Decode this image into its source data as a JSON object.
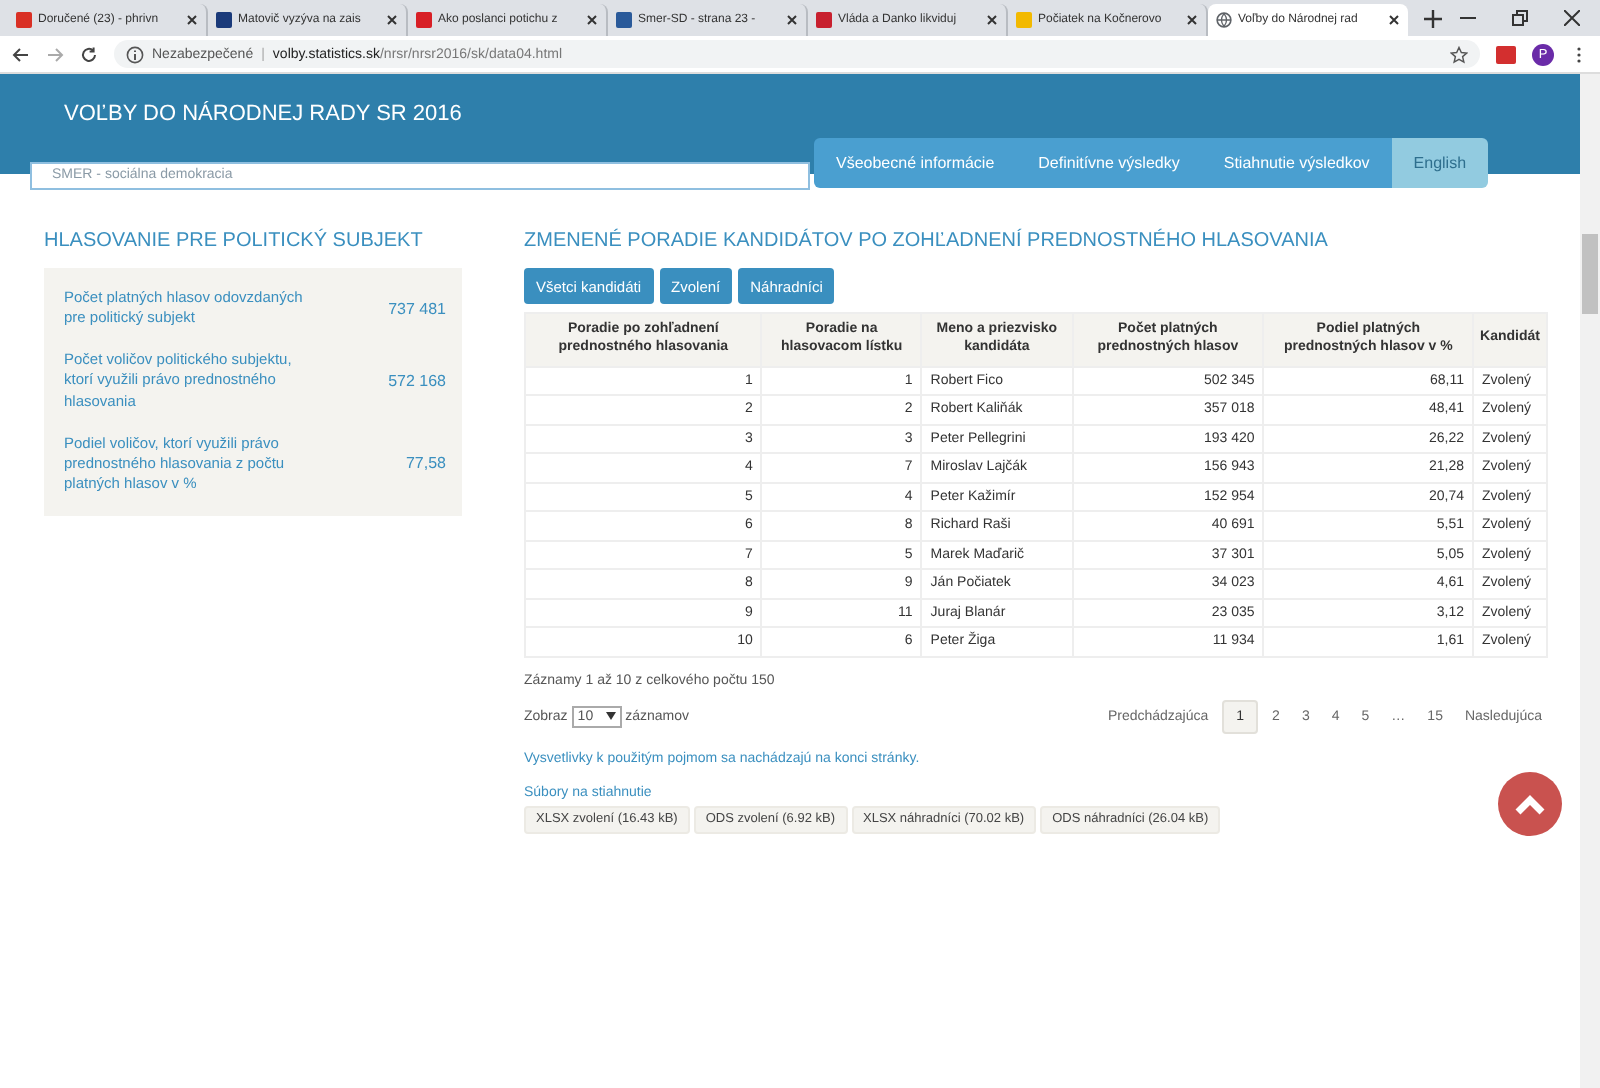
{
  "browser": {
    "tabs": [
      {
        "title": "Doručené (23) - phrivn",
        "selected": false
      },
      {
        "title": "Matovič vyzýva na zais",
        "selected": false
      },
      {
        "title": "Ako poslanci potichu z",
        "selected": false
      },
      {
        "title": "Smer-SD - strana 23 -",
        "selected": false
      },
      {
        "title": "Vláda a Danko likviduj",
        "selected": false
      },
      {
        "title": "Počiatek na Kočnerovo",
        "selected": false
      },
      {
        "title": "Voľby do Národnej rad",
        "selected": true
      }
    ],
    "security": "Nezabezpečené",
    "separator": "|",
    "url_host": "volby.statistics.sk",
    "url_path": "/nrsr/nrsr2016/sk/data04.html",
    "profile": "P"
  },
  "header": {
    "title": "VOĽBY DO NÁRODNEJ RADY SR 2016",
    "nav": [
      {
        "label": "Všeobecné informácie",
        "selected": false
      },
      {
        "label": "Definitívne výsledky",
        "selected": false
      },
      {
        "label": "Stiahnutie výsledkov",
        "selected": false
      },
      {
        "label": "English",
        "selected": true
      }
    ]
  },
  "party_field": {
    "value": "SMER - sociálna demokracia"
  },
  "summary": {
    "title": "HLASOVANIE PRE POLITICKÝ SUBJEKT",
    "rows": [
      {
        "label": "Počet platných hlasov odovzdaných pre politický subjekt",
        "value": "737 481"
      },
      {
        "label": "Počet voličov politického subjektu, ktorí využili právo prednostného hlasovania",
        "value": "572 168"
      },
      {
        "label": "Podiel voličov, ktorí využili právo prednostného hlasovania z počtu platných hlasov v %",
        "value": "77,58"
      }
    ]
  },
  "results": {
    "title": "ZMENENÉ PORADIE KANDIDÁTOV PO ZOHĽADNENÍ PREDNOSTNÉHO HLASOVANIA",
    "filters": [
      "Všetci kandidáti",
      "Zvolení",
      "Náhradníci"
    ],
    "columns": [
      "Poradie po zohľadnení prednostného hlasovania",
      "Poradie na hlasovacom lístku",
      "Meno a priezvisko kandidáta",
      "Počet platných prednostných hlasov",
      "Podiel platných prednostných hlasov v %",
      "Kandidát"
    ],
    "rows": [
      [
        "1",
        "1",
        "Robert Fico",
        "502 345",
        "68,11",
        "Zvolený"
      ],
      [
        "2",
        "2",
        "Robert Kaliňák",
        "357 018",
        "48,41",
        "Zvolený"
      ],
      [
        "3",
        "3",
        "Peter Pellegrini",
        "193 420",
        "26,22",
        "Zvolený"
      ],
      [
        "4",
        "7",
        "Miroslav Lajčák",
        "156 943",
        "21,28",
        "Zvolený"
      ],
      [
        "5",
        "4",
        "Peter Kažimír",
        "152 954",
        "20,74",
        "Zvolený"
      ],
      [
        "6",
        "8",
        "Richard Raši",
        "40 691",
        "5,51",
        "Zvolený"
      ],
      [
        "7",
        "5",
        "Marek Maďarič",
        "37 301",
        "5,05",
        "Zvolený"
      ],
      [
        "8",
        "9",
        "Ján Počiatek",
        "34 023",
        "4,61",
        "Zvolený"
      ],
      [
        "9",
        "11",
        "Juraj Blanár",
        "23 035",
        "3,12",
        "Zvolený"
      ],
      [
        "10",
        "6",
        "Peter Žiga",
        "11 934",
        "1,61",
        "Zvolený"
      ]
    ],
    "info": "Záznamy 1 až 10 z celkového počtu 150",
    "show_label": "Zobraz",
    "page_size": "10",
    "show_suffix": "záznamov",
    "pagination": [
      {
        "label": "Predchádzajúca",
        "selected": false
      },
      {
        "label": "1",
        "selected": true
      },
      {
        "label": "2",
        "selected": false
      },
      {
        "label": "3",
        "selected": false
      },
      {
        "label": "4",
        "selected": false
      },
      {
        "label": "5",
        "selected": false
      },
      {
        "label": "…",
        "selected": false
      },
      {
        "label": "15",
        "selected": false
      },
      {
        "label": "Nasledujúca",
        "selected": false
      }
    ],
    "note_link": "Vysvetlivky k použitým pojmom sa nachádzajú na konci stránky.",
    "downloads_title": "Súbory na stiahnutie",
    "downloads": [
      "XLSX zvolení (16.43 kB)",
      "ODS zvolení (6.92 kB)",
      "XLSX náhradníci (70.02 kB)",
      "ODS náhradníci (26.04 kB)"
    ]
  }
}
